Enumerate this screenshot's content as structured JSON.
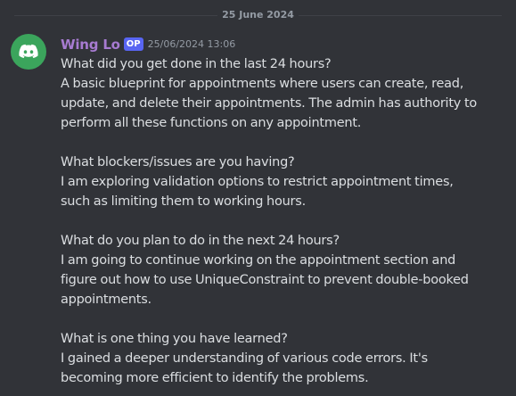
{
  "divider": {
    "date": "25 June 2024"
  },
  "message": {
    "author": "Wing Lo",
    "badge": "OP",
    "timestamp": "25/06/2024 13:06",
    "avatar_icon": "discord-logo-icon",
    "colors": {
      "background": "#313338",
      "author": "#a77bd1",
      "badge": "#5865f2",
      "avatar": "#3ba55c",
      "text": "#dbdee1",
      "muted": "#949ba4"
    },
    "sections": [
      {
        "question": "What did you get done in the last 24 hours?",
        "answer_lines": [
          "A basic blueprint for appointments where users can create, read,",
          "update, and delete their appointments. The admin has authority to",
          "perform all these functions on any appointment."
        ]
      },
      {
        "question": "What blockers/issues are you having?",
        "answer_lines": [
          "I am exploring validation options to restrict appointment times,",
          "such as limiting them to working hours."
        ]
      },
      {
        "question": "What do you plan to do in the next 24 hours?",
        "answer_lines": [
          "I am going to continue working on the appointment section and",
          "figure out how to use UniqueConstraint to prevent double-booked",
          "appointments."
        ]
      },
      {
        "question": "What is one thing you have learned?",
        "answer_lines": [
          "I gained a deeper understanding of various code errors. It's",
          "becoming more efficient to identify the problems."
        ]
      }
    ]
  }
}
